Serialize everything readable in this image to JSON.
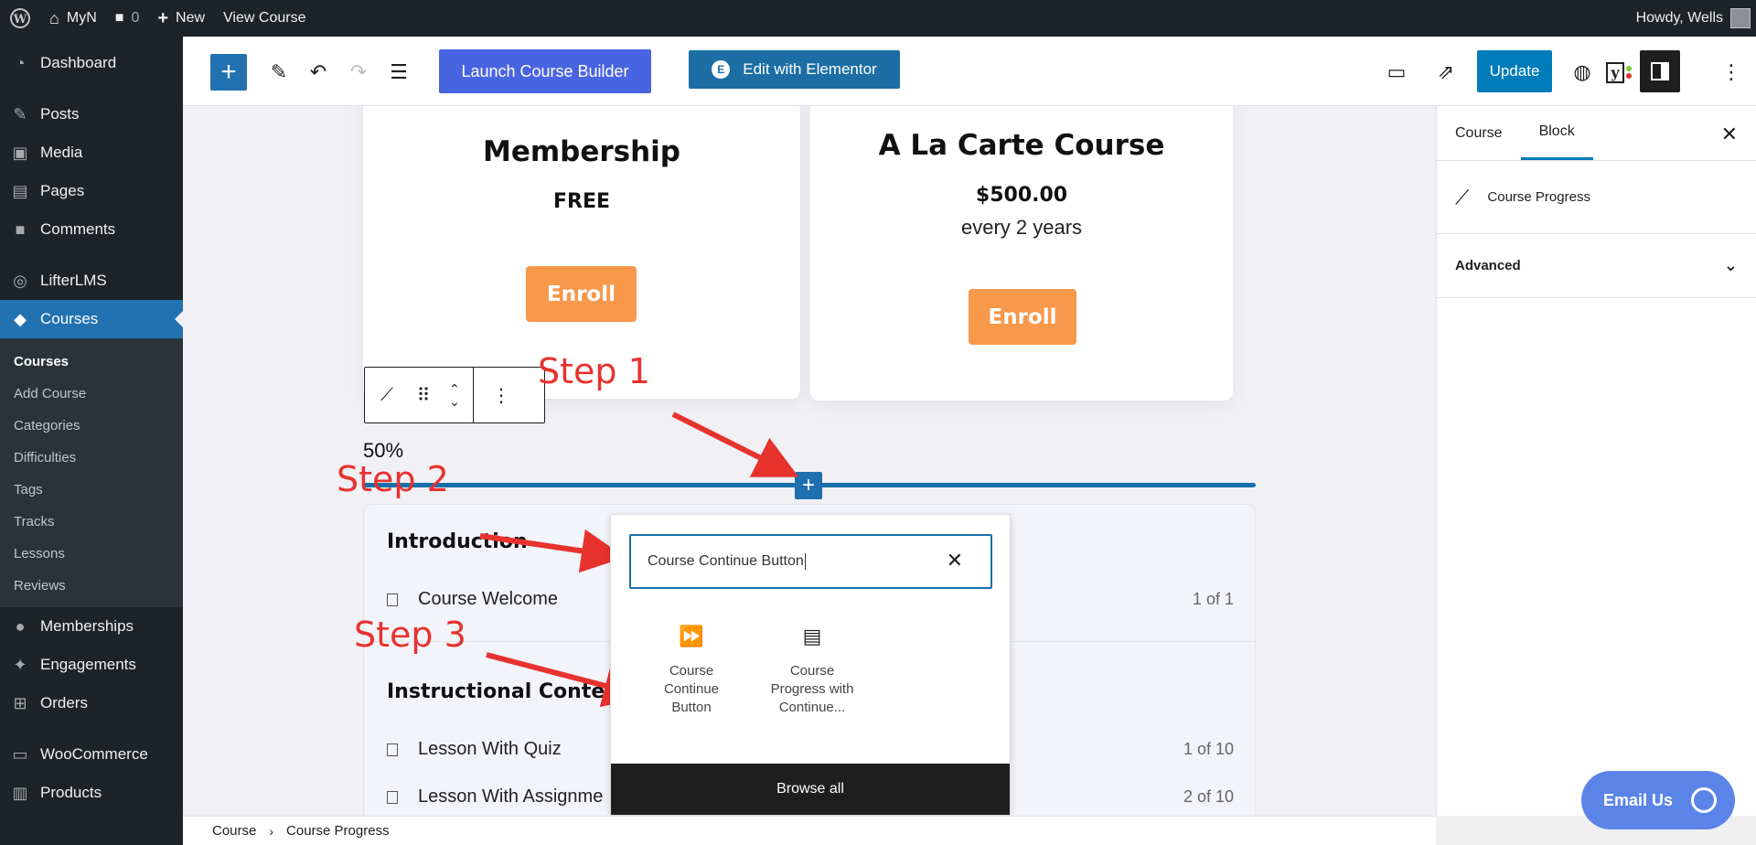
{
  "adminbar": {
    "site_name": "MyN",
    "comments_count": "0",
    "new_label": "New",
    "view_label": "View Course",
    "howdy": "Howdy, Wells"
  },
  "sidebar": {
    "items": [
      {
        "label": "Dashboard",
        "icon": "dashboard-icon"
      },
      {
        "label": "Posts",
        "icon": "pin-icon"
      },
      {
        "label": "Media",
        "icon": "media-icon"
      },
      {
        "label": "Pages",
        "icon": "pages-icon"
      },
      {
        "label": "Comments",
        "icon": "comments-icon"
      },
      {
        "label": "LifterLMS",
        "icon": "lifterlms-icon"
      },
      {
        "label": "Courses",
        "icon": "graduation-cap-icon"
      },
      {
        "label": "Memberships",
        "icon": "group-icon"
      },
      {
        "label": "Engagements",
        "icon": "trophy-icon"
      },
      {
        "label": "Orders",
        "icon": "cart-icon"
      },
      {
        "label": "WooCommerce",
        "icon": "woocommerce-icon"
      },
      {
        "label": "Products",
        "icon": "archive-icon"
      }
    ],
    "submenu": [
      "Courses",
      "Add Course",
      "Categories",
      "Difficulties",
      "Tags",
      "Tracks",
      "Lessons",
      "Reviews"
    ]
  },
  "toolbar": {
    "launch_label": "Launch Course Builder",
    "elementor_label": "Edit with Elementor",
    "update_label": "Update"
  },
  "cards": [
    {
      "title": "Membership",
      "price": "FREE",
      "button": "Enroll"
    },
    {
      "title": "A La Carte Course",
      "price": "$500.00",
      "period": "every 2 years",
      "button": "Enroll"
    }
  ],
  "progress": {
    "label": "50%",
    "value": 50
  },
  "steps": [
    "Step 1",
    "Step 2",
    "Step 3"
  ],
  "syllabus": {
    "sections": [
      {
        "title": "Introduction",
        "lessons": [
          {
            "title": "Course Welcome",
            "count": "1 of 1"
          }
        ]
      },
      {
        "title": "Instructional Conter",
        "lessons": [
          {
            "title": "Lesson With Quiz",
            "count": "1 of 10"
          },
          {
            "title": "Lesson With Assignme",
            "count": "2 of 10"
          }
        ]
      }
    ]
  },
  "inserter": {
    "search_value": "Course Continue Button",
    "results": [
      "Course Continue Button",
      "Course Progress with Continue..."
    ],
    "browse_all": "Browse all"
  },
  "panel": {
    "tabs": [
      "Course",
      "Block"
    ],
    "block_name": "Course Progress",
    "advanced": "Advanced"
  },
  "footer": {
    "crumbs": [
      "Course",
      "Course Progress"
    ]
  },
  "email_us": "Email Us",
  "colors": {
    "accent": "#2271b1",
    "enroll": "#f7984b",
    "annotation": "#e8322e",
    "update": "#007cba"
  }
}
